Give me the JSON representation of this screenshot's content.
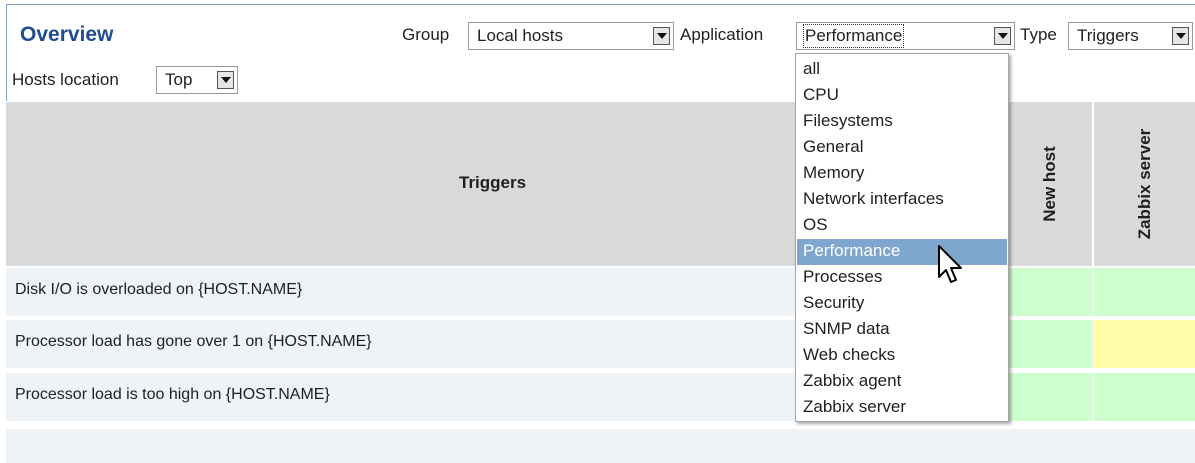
{
  "header": {
    "title": "Overview",
    "group_label": "Group",
    "group_value": "Local hosts",
    "application_label": "Application",
    "application_value": "Performance",
    "type_label": "Type",
    "type_value": "Triggers",
    "hosts_location_label": "Hosts location",
    "hosts_location_value": "Top"
  },
  "table": {
    "triggers_header": "Triggers",
    "hosts": [
      "New host",
      "Zabbix server"
    ],
    "rows": [
      {
        "trigger": "Disk I/O is overloaded on {HOST.NAME}",
        "statuses": [
          "#ccffcc",
          "#ccffcc"
        ]
      },
      {
        "trigger": "Processor load has gone over 1 on {HOST.NAME}",
        "statuses": [
          "#ccffcc",
          "#ffffaa"
        ]
      },
      {
        "trigger": "Processor load is too high on {HOST.NAME}",
        "statuses": [
          "#ccffcc",
          "#ccffcc"
        ]
      }
    ]
  },
  "application_dropdown": {
    "options": [
      "all",
      "CPU",
      "Filesystems",
      "General",
      "Memory",
      "Network interfaces",
      "OS",
      "Performance",
      "Processes",
      "Security",
      "SNMP data",
      "Web checks",
      "Zabbix agent",
      "Zabbix server"
    ],
    "selected": "Performance"
  },
  "colors": {
    "title": "#1f4d8f",
    "ok": "#ccffcc",
    "warning": "#ffffaa",
    "row_bg": "#eef3f8",
    "header_bg": "#d9d9d9",
    "selected_option": "#7fa6cf"
  },
  "cursor_icon": "mouse-pointer-icon"
}
